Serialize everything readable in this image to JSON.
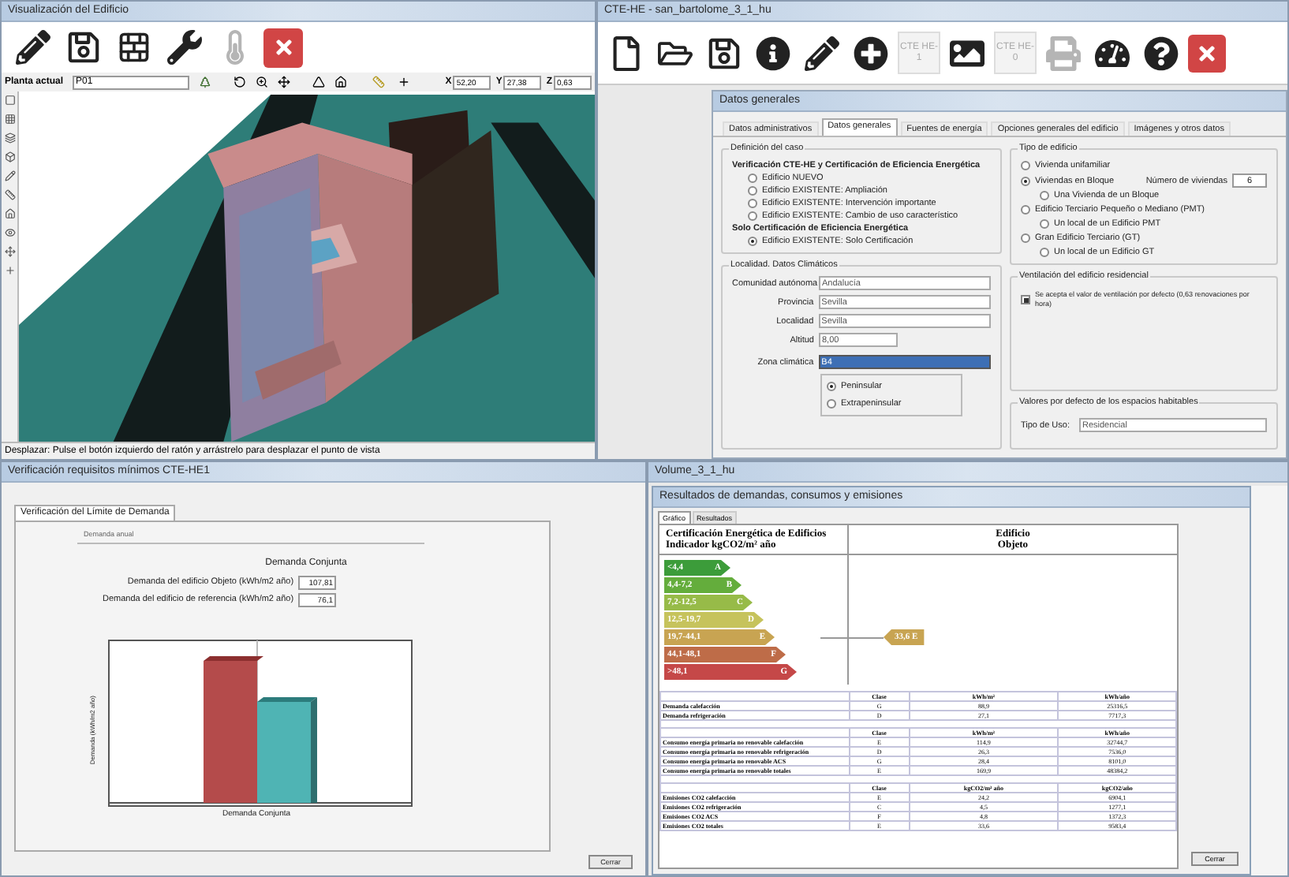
{
  "viewer": {
    "title": "Visualización del Edificio",
    "toolbar": [
      {
        "kind": "edit",
        "disabled": false
      },
      {
        "kind": "save",
        "disabled": false
      },
      {
        "kind": "wall",
        "disabled": false
      },
      {
        "kind": "tools",
        "disabled": false
      },
      {
        "kind": "thermo",
        "disabled": true
      },
      {
        "kind": "close",
        "disabled": false
      }
    ],
    "floor_label": "Planta actual",
    "floor_value": "P01",
    "coords": [
      {
        "label": "X",
        "value": "52,20"
      },
      {
        "label": "Y",
        "value": "27,38"
      },
      {
        "label": "Z",
        "value": "0,63"
      }
    ],
    "status": "Desplazar: Pulse el botón izquierdo del ratón y arrástrelo para desplazar el punto de vista"
  },
  "main": {
    "title": "CTE-HE - san_bartolome_3_1_hu",
    "toolbar": [
      {
        "kind": "new",
        "disabled": false
      },
      {
        "kind": "open",
        "disabled": false
      },
      {
        "kind": "save",
        "disabled": false
      },
      {
        "kind": "info",
        "disabled": false
      },
      {
        "kind": "edit",
        "disabled": false
      },
      {
        "kind": "add",
        "disabled": false
      },
      {
        "kind": "text",
        "label": "CTE HE-1",
        "disabled": true
      },
      {
        "kind": "image",
        "disabled": false
      },
      {
        "kind": "text",
        "label": "CTE HE-0",
        "disabled": true
      },
      {
        "kind": "print",
        "disabled": true
      },
      {
        "kind": "gauge",
        "disabled": false
      },
      {
        "kind": "help",
        "disabled": false
      },
      {
        "kind": "close",
        "disabled": false
      }
    ],
    "dialog": {
      "title": "Datos generales",
      "tabs": [
        {
          "label": "Datos administrativos",
          "selected": false
        },
        {
          "label": "Datos generales",
          "selected": true
        },
        {
          "label": "Fuentes de energía",
          "selected": false
        },
        {
          "label": "Opciones generales del edificio",
          "selected": false
        },
        {
          "label": "Imágenes y otros datos",
          "selected": false
        }
      ],
      "case": {
        "title": "Definición del caso",
        "sections": [
          {
            "heading": "Verificación CTE-HE y Certificación de Eficiencia Energética",
            "options": [
              {
                "label": "Edificio NUEVO",
                "selected": false
              },
              {
                "label": "Edificio EXISTENTE: Ampliación",
                "selected": false
              },
              {
                "label": "Edificio EXISTENTE: Intervención importante",
                "selected": false
              },
              {
                "label": "Edificio EXISTENTE: Cambio de uso característico",
                "selected": false
              }
            ]
          },
          {
            "heading": "Solo Certificación de Eficiencia Energética",
            "options": [
              {
                "label": "Edificio EXISTENTE: Solo Certificación",
                "selected": true
              }
            ]
          }
        ]
      },
      "building_type": {
        "title": "Tipo de edificio",
        "options": [
          {
            "label": "Vivienda unifamiliar",
            "selected": false
          },
          {
            "label": "Viviendas en Bloque",
            "selected": true,
            "field_label": "Número de viviendas",
            "field_value": "6",
            "children": [
              {
                "label": "Una Vivienda de un Bloque",
                "selected": false
              }
            ]
          },
          {
            "label": "Edificio Terciario Pequeño o Mediano (PMT)",
            "selected": false,
            "children": [
              {
                "label": "Un local de un Edificio PMT",
                "selected": false
              }
            ]
          },
          {
            "label": "Gran Edificio Terciario (GT)",
            "selected": false,
            "children": [
              {
                "label": "Un local de un Edificio GT",
                "selected": false
              }
            ]
          }
        ]
      },
      "location": {
        "title": "Localidad. Datos Climáticos",
        "fields": [
          {
            "label": "Comunidad autónoma",
            "value": "Andalucía"
          },
          {
            "label": "Provincia",
            "value": "Sevilla"
          },
          {
            "label": "Localidad",
            "value": "Sevilla"
          },
          {
            "label": "Altitud",
            "value": "8,00"
          }
        ],
        "zone_label": "Zona climática",
        "zone_value": "B4",
        "regions": [
          {
            "label": "Peninsular",
            "selected": true
          },
          {
            "label": "Extrapeninsular",
            "selected": false
          }
        ]
      },
      "ventilation": {
        "title": "Ventilación del edificio residencial",
        "label": "Se acepta el valor de ventilación por defecto (0,63 renovaciones por hora)",
        "checked": true
      },
      "defaults": {
        "title": "Valores por defecto de los espacios habitables",
        "label": "Tipo de Uso:",
        "value": "Residencial"
      }
    }
  },
  "demand": {
    "title": "Verificación requisitos mínimos CTE-HE1",
    "tab": "Verificación del Límite de Demanda",
    "group": "Demanda anual",
    "heading": "Demanda Conjunta",
    "rows": [
      {
        "label": "Demanda del edificio Objeto (kWh/m2 año)",
        "value": "107,81"
      },
      {
        "label": "Demanda del edificio de referencia (kWh/m2 año)",
        "value": "76,1"
      }
    ],
    "chart": {
      "xlabel": "Demanda Conjunta",
      "ylabel": "Demanda (kWh/m2 año)"
    },
    "button": "Cerrar"
  },
  "results": {
    "window_title": "Volume_3_1_hu",
    "title": "Resultados de demandas, consumos y emisiones",
    "tabs": [
      {
        "label": "Gráfico",
        "selected": true
      },
      {
        "label": "Resultados",
        "selected": false
      }
    ],
    "header_left": [
      "Certificación Energética de Edificios",
      "Indicador kgCO2/m² año"
    ],
    "header_right": [
      "Edificio",
      "Objeto"
    ],
    "scale": [
      {
        "range": "<4,4",
        "letter": "A",
        "color": "#3c9c3a"
      },
      {
        "range": "4,4-7,2",
        "letter": "B",
        "color": "#64ad3c"
      },
      {
        "range": "7,2-12,5",
        "letter": "C",
        "color": "#97bb48"
      },
      {
        "range": "12,5-19,7",
        "letter": "D",
        "color": "#c6c35c"
      },
      {
        "range": "19,7-44,1",
        "letter": "E",
        "color": "#c8a452",
        "marker": "33,6 E"
      },
      {
        "range": "44,1-48,1",
        "letter": "F",
        "color": "#be6c48"
      },
      {
        "range": ">48,1",
        "letter": "G",
        "color": "#c54848"
      }
    ],
    "tables": [
      {
        "columns": [
          "",
          "Clase",
          "kWh/m²",
          "kWh/año"
        ],
        "rows": [
          [
            "Demanda calefacción",
            "G",
            "88,9",
            "25316,5"
          ],
          [
            "Demanda refrigeración",
            "D",
            "27,1",
            "7717,3"
          ]
        ]
      },
      {
        "columns": [
          "",
          "Clase",
          "kWh/m²",
          "kWh/año"
        ],
        "rows": [
          [
            "Consumo energía primaria no renovable calefacción",
            "E",
            "114,9",
            "32744,7"
          ],
          [
            "Consumo energía primaria no renovable refrigeración",
            "D",
            "26,3",
            "7536,0"
          ],
          [
            "Consumo energía primaria no renovable ACS",
            "G",
            "28,4",
            "8101,0"
          ],
          [
            "Consumo energía primaria no renovable totales",
            "E",
            "169,9",
            "48384,2"
          ]
        ]
      },
      {
        "columns": [
          "",
          "Clase",
          "kgCO2/m² año",
          "kgCO2/año"
        ],
        "rows": [
          [
            "Emisiones CO2 calefacción",
            "E",
            "24,2",
            "6904,1"
          ],
          [
            "Emisiones CO2 refrigeración",
            "C",
            "4,5",
            "1277,1"
          ],
          [
            "Emisiones CO2 ACS",
            "F",
            "4,8",
            "1372,3"
          ],
          [
            "Emisiones CO2 totales",
            "E",
            "33,6",
            "9583,4"
          ]
        ]
      }
    ],
    "button": "Cerrar"
  }
}
